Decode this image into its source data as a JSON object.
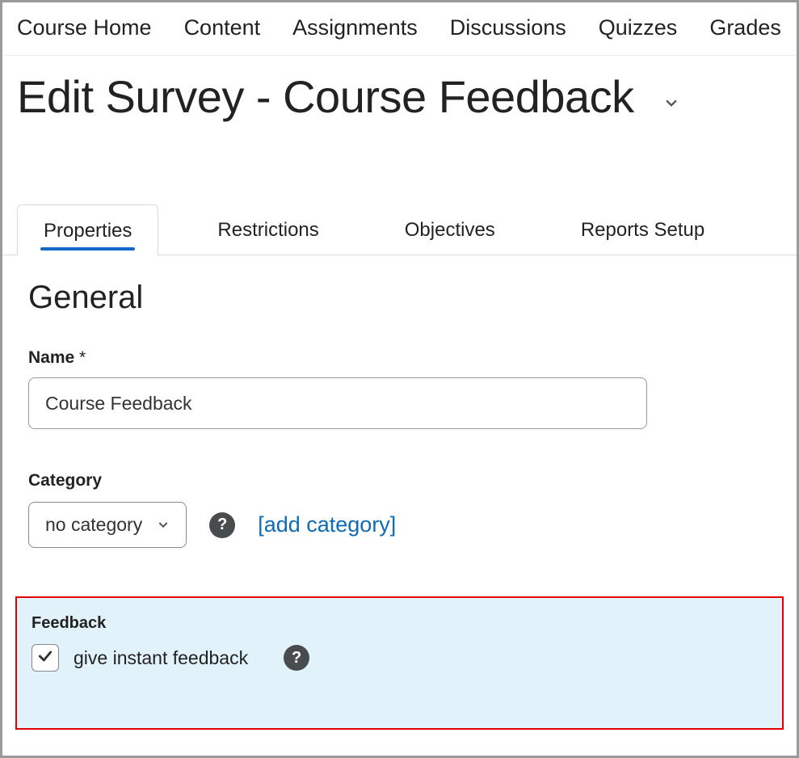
{
  "nav": {
    "items": [
      "Course Home",
      "Content",
      "Assignments",
      "Discussions",
      "Quizzes",
      "Grades"
    ]
  },
  "heading": "Edit Survey - Course Feedback",
  "tabs": {
    "items": [
      "Properties",
      "Restrictions",
      "Objectives",
      "Reports Setup"
    ],
    "active_index": 0
  },
  "general": {
    "section_title": "General",
    "name_label": "Name",
    "required_mark": "*",
    "name_value": "Course Feedback",
    "category_label": "Category",
    "category_value": "no category",
    "add_category_label": "[add category]"
  },
  "feedback": {
    "section_label": "Feedback",
    "checkbox_label": "give instant feedback",
    "checked": true
  },
  "icons": {
    "help_glyph": "?"
  }
}
